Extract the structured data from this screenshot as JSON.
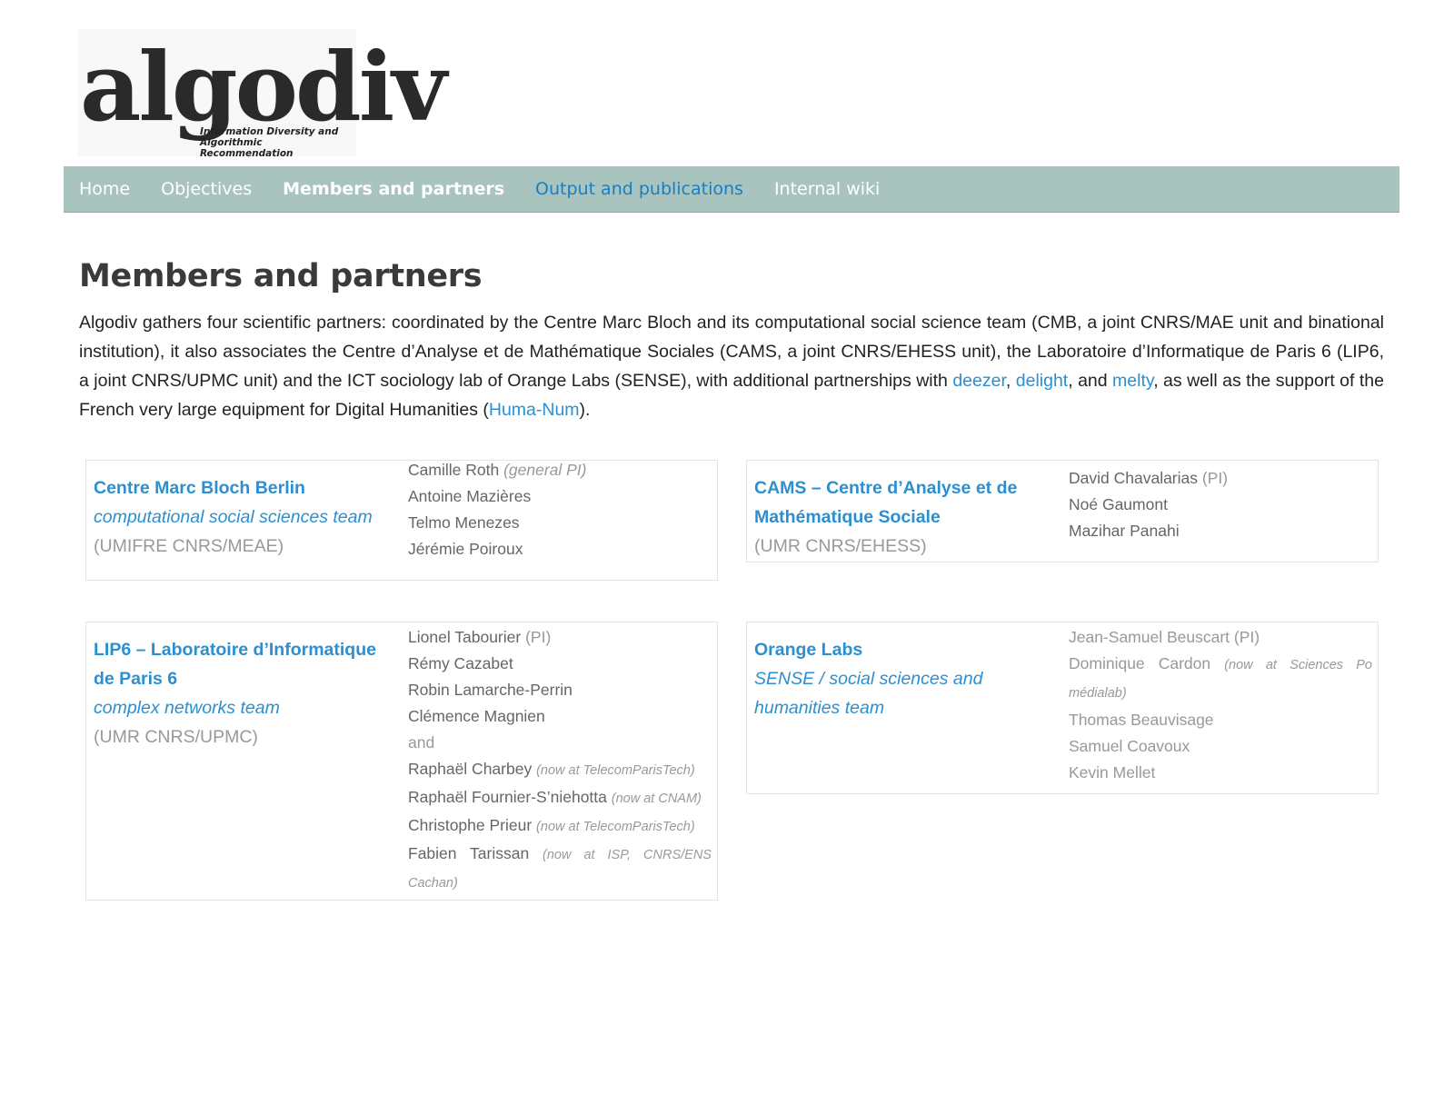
{
  "logo": {
    "wordmark": "algodiv",
    "tagline_1": "Information Diversity and",
    "tagline_2": "Algorithmic Recommendation"
  },
  "nav": {
    "home": "Home",
    "objectives": "Objectives",
    "members": "Members and partners",
    "output": "Output and publications",
    "wiki": "Internal wiki"
  },
  "page_title": "Members and partners",
  "intro": {
    "text_1": "Algodiv gathers four scientific partners: coordinated by the Centre Marc Bloch and its computational social science team (CMB, a joint CNRS/MAE unit and binational institution), it also associates the Centre d’Analyse et de Mathématique Sociales (CAMS, a joint CNRS/EHESS unit), the Laboratoire d’Informatique de Paris 6 (LIP6, a joint CNRS/UPMC unit) and the ICT sociology lab of Orange Labs (SENSE), with additional partnerships with ",
    "link_deezer": "deezer",
    "sep_1": ", ",
    "link_delight": "delight",
    "sep_2": ", and ",
    "link_melty": "melty",
    "text_2": ", as well as the support of the French very large equipment for Digital Humanities (",
    "link_humanum": "Huma-Num",
    "text_3": ")."
  },
  "partners": {
    "cmb": {
      "name": "Centre Marc Bloch Berlin",
      "team": "computational social sciences team",
      "unit": "(UMIFRE CNRS/MEAE)",
      "m1": "Camille Roth",
      "m1_role": "(general PI)",
      "m2": "Antoine Mazières",
      "m3": "Telmo Menezes",
      "m4": "Jérémie Poiroux"
    },
    "cams": {
      "name": "CAMS – Centre d’Analyse et de Mathématique Sociale",
      "unit": "(UMR CNRS/EHESS)",
      "m1": "David Chavalarias",
      "m1_role": "(PI)",
      "m2": "Noé Gaumont",
      "m3": "Mazihar Panahi"
    },
    "lip6": {
      "name": "LIP6 – Laboratoire d’Informatique de Paris 6",
      "team": "complex networks team",
      "unit": "(UMR CNRS/UPMC)",
      "m1": "Lionel Tabourier",
      "m1_role": "(PI)",
      "m2": "Rémy Cazabet",
      "m3": "Robin Lamarche-Perrin",
      "m4": "Clémence Magnien",
      "and": "and",
      "m5": "Raphaël Charbey",
      "m5_note": "(now at TelecomParisTech)",
      "m6": "Raphaël Fournier-S’niehotta",
      "m6_note": "(now at CNAM)",
      "m7": "Christophe Prieur",
      "m7_note": "(now at TelecomParisTech)",
      "m8": "Fabien Tarissan",
      "m8_note": "(now at ISP, CNRS/ENS Cachan)"
    },
    "orange": {
      "name": "Orange Labs",
      "team": "SENSE / social sciences and humanities team",
      "m1": "Jean-Samuel Beuscart",
      "m1_role": "(PI)",
      "m2": "Dominique Cardon",
      "m2_note": "(now at Sciences Po médialab)",
      "m3": "Thomas Beauvisage",
      "m4": "Samuel Coavoux",
      "m5": "Kevin Mellet"
    }
  }
}
